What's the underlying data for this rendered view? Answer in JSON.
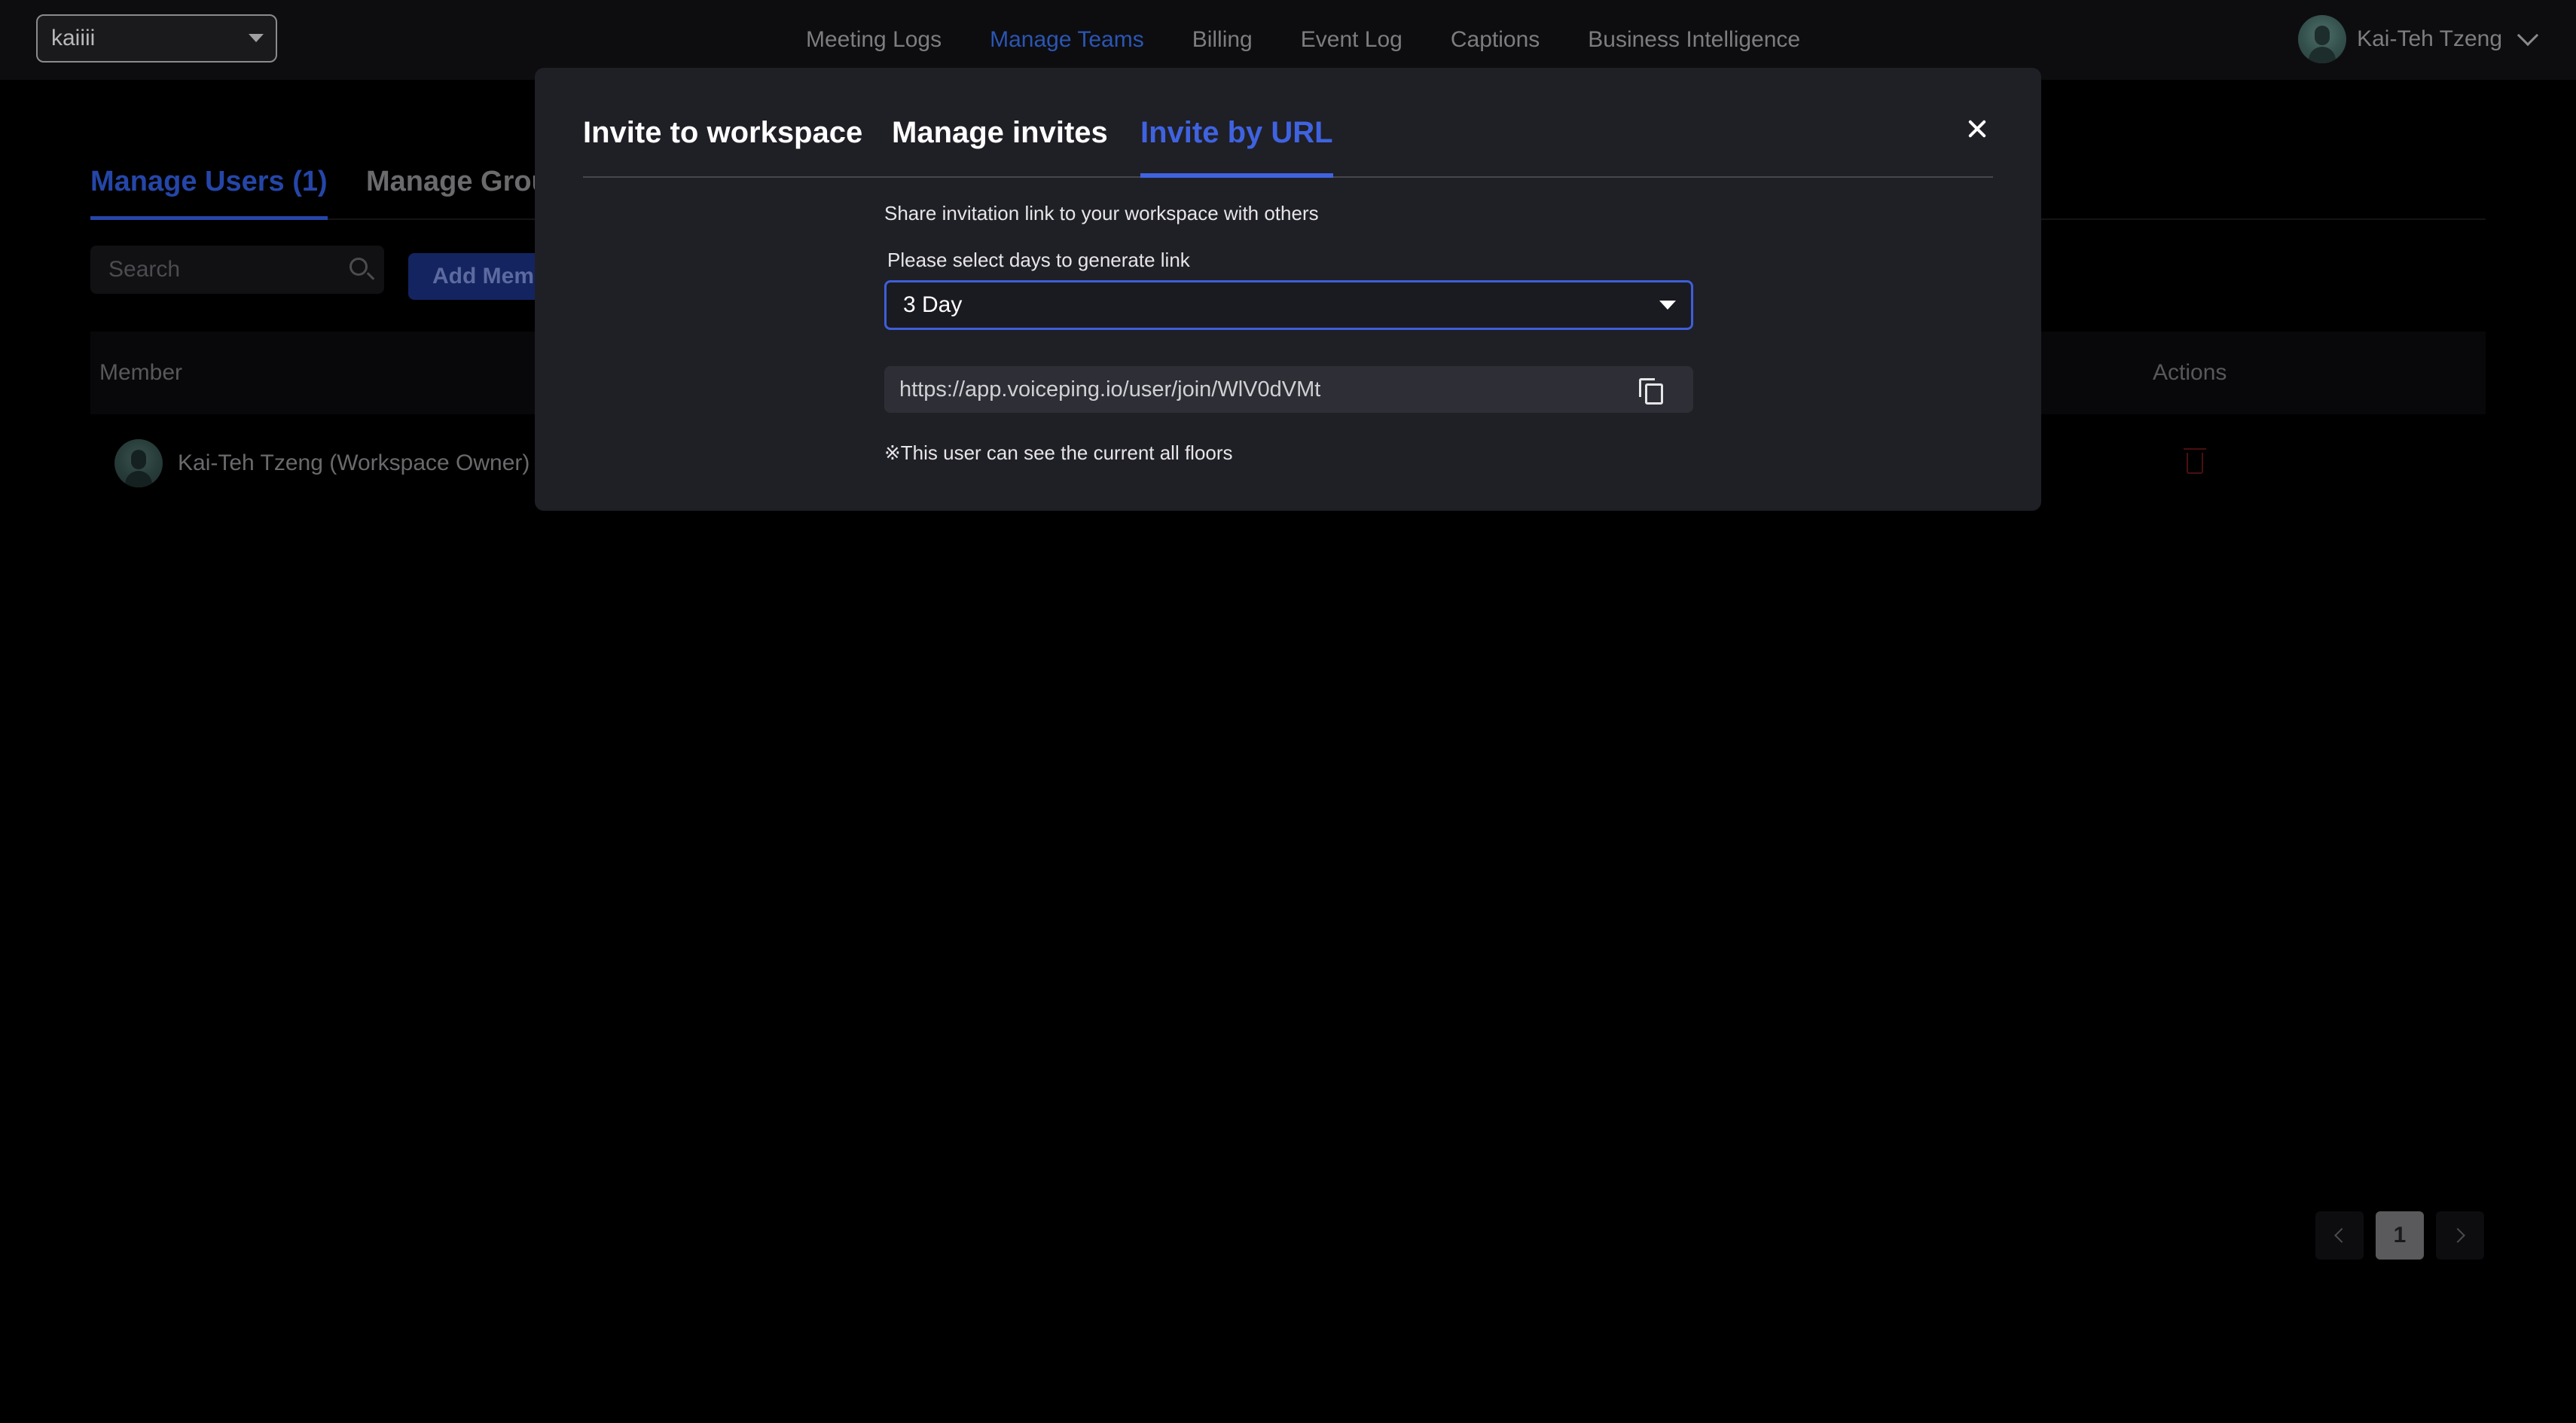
{
  "topbar": {
    "workspace_value": "kaiiii",
    "nav": [
      {
        "label": "Meeting Logs",
        "active": false
      },
      {
        "label": "Manage Teams",
        "active": true
      },
      {
        "label": "Billing",
        "active": false
      },
      {
        "label": "Event Log",
        "active": false
      },
      {
        "label": "Captions",
        "active": false
      },
      {
        "label": "Business Intelligence",
        "active": false
      }
    ],
    "user_name": "Kai-Teh Tzeng",
    "avatar_icon": "user-avatar",
    "menu_icon": "chevron-down-icon"
  },
  "page": {
    "tabs": [
      {
        "label": "Manage Users (1)",
        "active": true
      },
      {
        "label": "Manage Grou",
        "active": false
      }
    ],
    "search_placeholder": "Search",
    "add_member_label": "Add Memb",
    "table": {
      "columns": [
        "Member",
        "Actions"
      ],
      "rows": [
        {
          "member": "Kai-Teh Tzeng (Workspace Owner)",
          "action_icon": "trash-icon"
        }
      ]
    },
    "pagination": {
      "current_page": "1",
      "prev_icon": "chevron-left-icon",
      "next_icon": "chevron-right-icon"
    }
  },
  "modal": {
    "tabs": [
      {
        "label": "Invite to workspace",
        "active": false
      },
      {
        "label": "Manage invites",
        "active": false
      },
      {
        "label": "Invite by URL",
        "active": true
      }
    ],
    "share_text": "Share invitation link to your workspace with others",
    "select_label": "Please select days to generate link",
    "select_value": "3 Day",
    "invite_url": "https://app.voiceping.io/user/join/WlV0dVMt",
    "note": "※This user can see the current all floors",
    "close_icon": "close-icon",
    "copy_icon": "copy-icon",
    "accent_color": "#3f63e0"
  }
}
